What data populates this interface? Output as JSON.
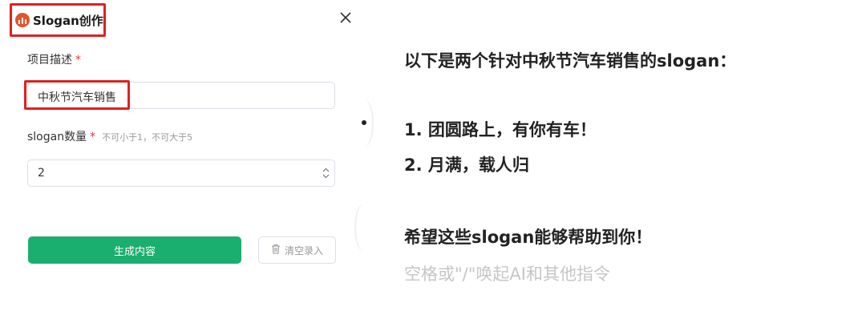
{
  "panel": {
    "title": "Slogan创作",
    "fields": {
      "project_desc": {
        "label": "项目描述",
        "required_mark": "*",
        "value": "中秋节汽车销售"
      },
      "slogan_count": {
        "label": "slogan数量",
        "required_mark": "*",
        "hint": "不可小于1，不可大于5",
        "value": "2"
      }
    },
    "generate_button": "生成内容",
    "clear_button": "清空录入"
  },
  "output": {
    "intro": "以下是两个针对中秋节汽车销售的slogan：",
    "slogans": [
      "1. 团圆路上，有你有车！",
      "2. 月满，载人归"
    ],
    "closing": "希望这些slogan能够帮助到你！",
    "placeholder": "空格或\"/\"唤起AI和其他指令"
  },
  "colors": {
    "accent_green": "#1aae6f",
    "highlight_red": "#e02020",
    "required_red": "#e53935"
  },
  "icons": [
    "app-logo-icon",
    "close-icon",
    "chevron-up-icon",
    "chevron-down-icon",
    "trash-icon"
  ]
}
